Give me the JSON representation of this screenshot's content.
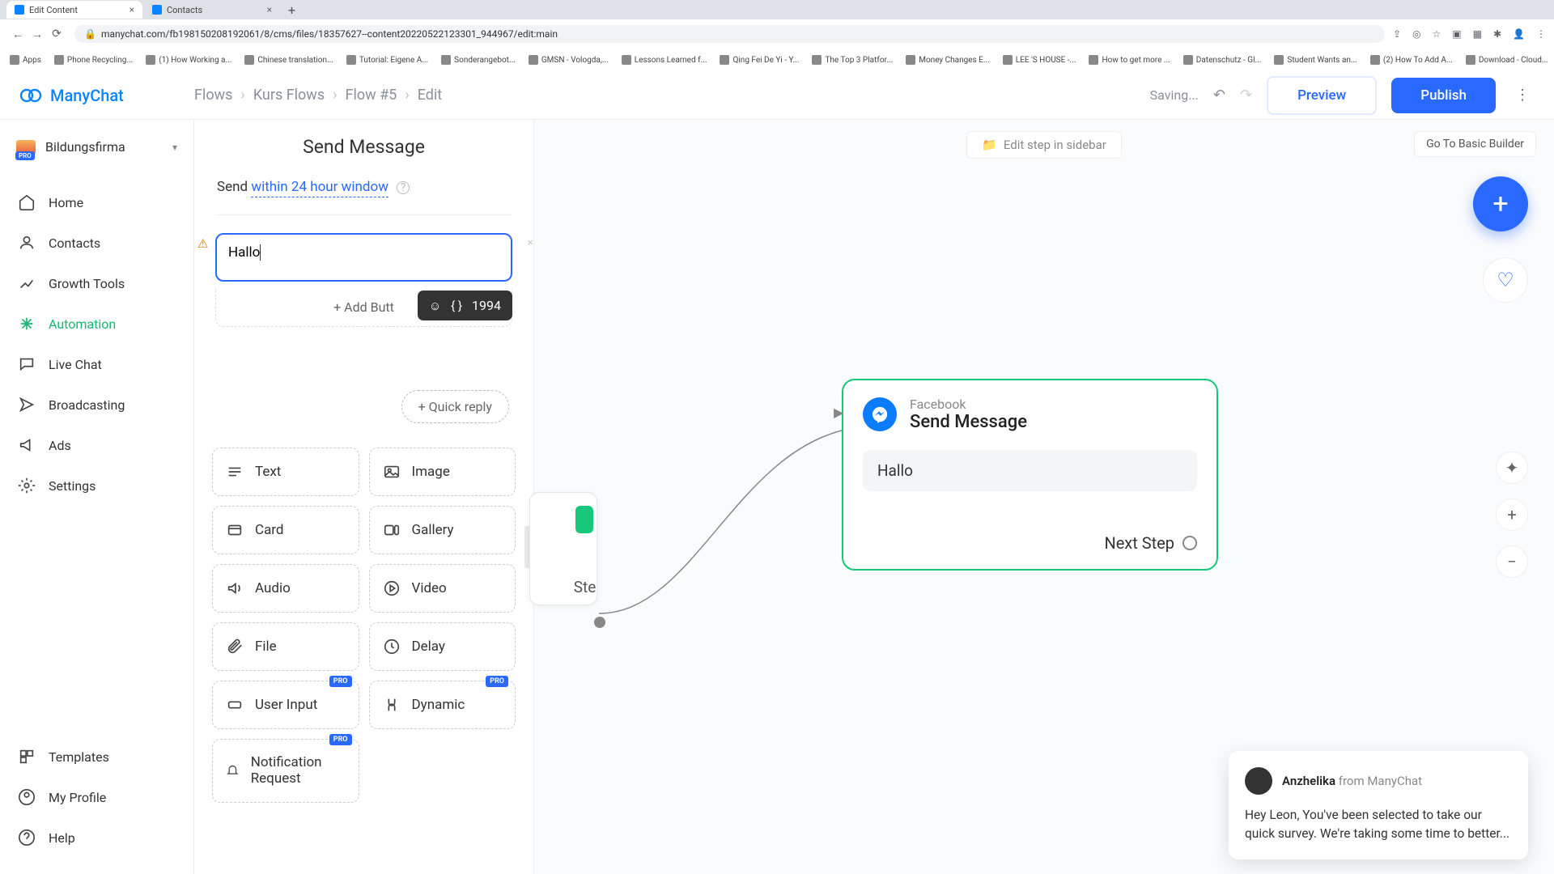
{
  "browser": {
    "tabs": [
      {
        "title": "Edit Content",
        "active": true
      },
      {
        "title": "Contacts",
        "active": false
      }
    ],
    "url": "manychat.com/fb198150208192061/8/cms/files/18357627--content20220522123301_944967/edit:main",
    "bookmarks": [
      "Apps",
      "Phone Recycling...",
      "(1) How Working a...",
      "Chinese translation...",
      "Tutorial: Eigene A...",
      "Sonderangebot...",
      "GMSN - Vologda,...",
      "Lessons Learned f...",
      "Qing Fei De Yi - Y...",
      "The Top 3 Platfor...",
      "Money Changes E...",
      "LEE 'S HOUSE -...",
      "How to get more ...",
      "Datenschutz - Gl...",
      "Student Wants an...",
      "(2) How To Add A...",
      "Download - Cloud..."
    ]
  },
  "brand": {
    "name": "ManyChat"
  },
  "breadcrumbs": [
    "Flows",
    "Kurs Flows",
    "Flow #5",
    "Edit"
  ],
  "header": {
    "saving": "Saving...",
    "preview": "Preview",
    "publish": "Publish"
  },
  "account": {
    "name": "Bildungsfirma",
    "pro": "PRO"
  },
  "nav": {
    "home": "Home",
    "contacts": "Contacts",
    "growth_tools": "Growth Tools",
    "automation": "Automation",
    "live_chat": "Live Chat",
    "broadcasting": "Broadcasting",
    "ads": "Ads",
    "settings": "Settings",
    "templates": "Templates",
    "my_profile": "My Profile",
    "help": "Help"
  },
  "editor": {
    "title": "Send Message",
    "send_label": "Send",
    "send_link": "within 24 hour window",
    "text_value": "Hallo ",
    "char_count": "1994",
    "add_button": "+ Add Butt",
    "quick_reply": "+ Quick reply",
    "blocks": {
      "text": "Text",
      "image": "Image",
      "card": "Card",
      "gallery": "Gallery",
      "audio": "Audio",
      "video": "Video",
      "file": "File",
      "delay": "Delay",
      "user_input": "User Input",
      "dynamic": "Dynamic",
      "notification_request": "Notification Request"
    },
    "pro_label": "PRO"
  },
  "canvas": {
    "edit_sidebar": "Edit step in sidebar",
    "go_basic": "Go To Basic Builder",
    "peek_label": "Step",
    "node": {
      "channel": "Facebook",
      "title": "Send Message",
      "body": "Hallo",
      "next": "Next Step"
    }
  },
  "chat": {
    "name": "Anzhelika",
    "from": " from ManyChat",
    "body": "Hey Leon,  You've been selected to take our quick survey. We're taking some time to better..."
  }
}
